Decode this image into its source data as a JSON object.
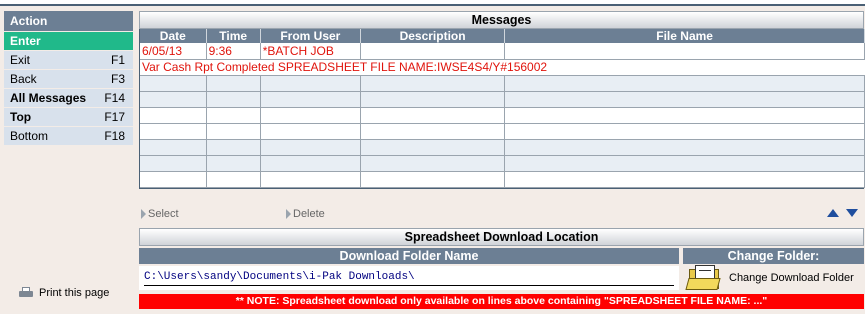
{
  "action": {
    "header": "Action",
    "items": [
      {
        "label": "Enter",
        "key": ""
      },
      {
        "label": "Exit",
        "key": "F1"
      },
      {
        "label": "Back",
        "key": "F3"
      },
      {
        "label": "All Messages",
        "key": "F14"
      },
      {
        "label": "Top",
        "key": "F17"
      },
      {
        "label": "Bottom",
        "key": "F18"
      }
    ],
    "print_label": "Print this page"
  },
  "messages": {
    "title": "Messages",
    "columns": [
      "Date",
      "Time",
      "From User",
      "Description",
      "File Name"
    ],
    "row1": {
      "date": "6/05/13",
      "time": "9:36",
      "from_user": "*BATCH JOB",
      "description": "",
      "file_name": ""
    },
    "row1_detail": "Var Cash Rpt Completed SPREADSHEET FILE NAME:IWSE4S4/Y#156002"
  },
  "commands": {
    "select": "Select",
    "delete": "Delete"
  },
  "download": {
    "title": "Spreadsheet Download Location",
    "folder_header": "Download Folder Name",
    "folder_path": "C:\\Users\\sandy\\Documents\\i-Pak Downloads\\",
    "change_header": "Change Folder:",
    "change_label": "Change Download Folder",
    "note": "** NOTE:  Spreadsheet download only available on lines above containing \"SPREADSHEET FILE NAME: ...\""
  },
  "colors": {
    "header_bg": "#6c7f94",
    "selected_green": "#20b98a",
    "message_text": "#e0140c",
    "note_red": "#ff0000"
  }
}
